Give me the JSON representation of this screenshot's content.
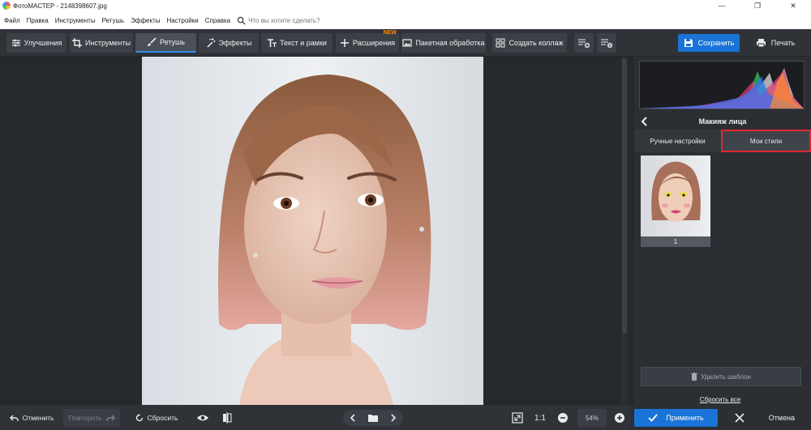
{
  "window": {
    "title": "ФотоМАСТЕР - 2148398607.jpg",
    "minimize": "—",
    "maximize": "❐",
    "close": "✕"
  },
  "menu": {
    "items": [
      "Файл",
      "Правка",
      "Инструменты",
      "Ретушь",
      "Эффекты",
      "Настройки",
      "Справка"
    ],
    "search_placeholder": "Что вы хотите сделать?"
  },
  "toolbar": {
    "tabs": [
      {
        "label": "Улучшения",
        "icon": "sliders-icon"
      },
      {
        "label": "Инструменты",
        "icon": "crop-icon"
      },
      {
        "label": "Ретушь",
        "icon": "brush-icon",
        "active": true
      },
      {
        "label": "Эффекты",
        "icon": "magic-wand-icon"
      },
      {
        "label": "Текст и рамки",
        "icon": "text-icon"
      },
      {
        "label": "Расширения",
        "icon": "plus-icon",
        "badge": "NEW"
      },
      {
        "label": "Пакетная обработка",
        "icon": "image-stack-icon"
      },
      {
        "label": "Создать коллаж",
        "icon": "grid-icon"
      }
    ],
    "save_label": "Сохранить",
    "print_label": "Печать"
  },
  "panel": {
    "title": "Макияж лица",
    "subtabs": [
      {
        "label": "Ручные настройки"
      },
      {
        "label": "Мои стили",
        "active": true
      }
    ],
    "styles": [
      {
        "label": "1"
      }
    ],
    "delete_label": "Удалить шаблон",
    "reset_all_label": "Сбросить все"
  },
  "bottom": {
    "undo_label": "Отменить",
    "redo_label": "Повторить",
    "reset_label": "Сбросить",
    "zoom_ratio": "1:1",
    "zoom_value": "54%",
    "apply_label": "Применить",
    "cancel_label": "Отмена"
  },
  "colors": {
    "accent": "#1a73d6",
    "highlight": "#e3262e",
    "new_badge": "#ff8c1a"
  }
}
